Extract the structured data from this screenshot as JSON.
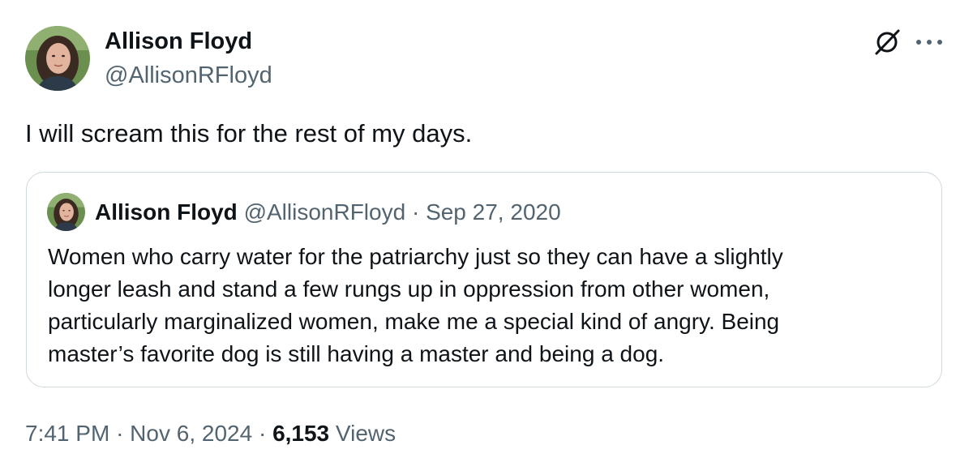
{
  "author": {
    "name": "Allison Floyd",
    "handle": "@AllisonRFloyd"
  },
  "header_icons": [
    "grok-icon",
    "more-options-icon"
  ],
  "tweet_text": "I will scream this for the rest of my days.",
  "quoted": {
    "name": "Allison Floyd",
    "handle": "@AllisonRFloyd",
    "separator": "·",
    "date": "Sep 27, 2020",
    "lines": [
      "Women who carry water for the patriarchy just so they can have a slightly",
      "longer leash and stand a few rungs up in oppression from other women,",
      "particularly marginalized women, make me a special kind of angry. Being",
      "master’s favorite dog is still having a master and being a dog."
    ]
  },
  "meta": {
    "time": "7:41 PM",
    "sep1": "·",
    "date": "Nov 6, 2024",
    "sep2": "·",
    "views_count": "6,153",
    "views_label": "Views"
  },
  "colors": {
    "text": "#0f1419",
    "muted": "#536471",
    "border": "#cfd9de"
  }
}
